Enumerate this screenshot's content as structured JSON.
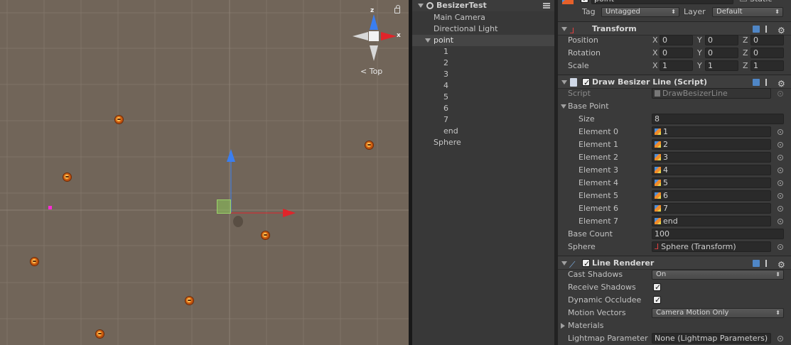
{
  "scene": {
    "view_label": "Top",
    "axes": {
      "x": "x",
      "z": "z"
    }
  },
  "hierarchy": {
    "scene_name": "BesizerTest",
    "items": [
      {
        "label": "Main Camera"
      },
      {
        "label": "Directional Light"
      },
      {
        "label": "point"
      },
      {
        "label": "1"
      },
      {
        "label": "2"
      },
      {
        "label": "3"
      },
      {
        "label": "4"
      },
      {
        "label": "5"
      },
      {
        "label": "6"
      },
      {
        "label": "7"
      },
      {
        "label": "end"
      },
      {
        "label": "Sphere"
      }
    ]
  },
  "inspector": {
    "object_name": "point",
    "static_label": "Static",
    "tag_label": "Tag",
    "tag_value": "Untagged",
    "layer_label": "Layer",
    "layer_value": "Default",
    "transform": {
      "title": "Transform",
      "position_label": "Position",
      "rotation_label": "Rotation",
      "scale_label": "Scale",
      "position": {
        "x": "0",
        "y": "0",
        "z": "0"
      },
      "rotation": {
        "x": "0",
        "y": "0",
        "z": "0"
      },
      "scale": {
        "x": "1",
        "y": "1",
        "z": "1"
      },
      "x": "X",
      "y": "Y",
      "z": "Z"
    },
    "script_component": {
      "title": "Draw Besizer Line (Script)",
      "script_label": "Script",
      "script_value": "DrawBesizerLine",
      "base_point_label": "Base Point",
      "size_label": "Size",
      "size_value": "8",
      "elements": [
        {
          "label": "Element 0",
          "value": "1"
        },
        {
          "label": "Element 1",
          "value": "2"
        },
        {
          "label": "Element 2",
          "value": "3"
        },
        {
          "label": "Element 3",
          "value": "4"
        },
        {
          "label": "Element 4",
          "value": "5"
        },
        {
          "label": "Element 5",
          "value": "6"
        },
        {
          "label": "Element 6",
          "value": "7"
        },
        {
          "label": "Element 7",
          "value": "end"
        }
      ],
      "base_count_label": "Base Count",
      "base_count_value": "100",
      "sphere_label": "Sphere",
      "sphere_value": "Sphere (Transform)"
    },
    "line_renderer": {
      "title": "Line Renderer",
      "cast_shadows_label": "Cast Shadows",
      "cast_shadows_value": "On",
      "receive_shadows_label": "Receive Shadows",
      "dynamic_occludee_label": "Dynamic Occludee",
      "motion_vectors_label": "Motion Vectors",
      "motion_vectors_value": "Camera Motion Only",
      "materials_label": "Materials",
      "lightmap_label": "Lightmap Parameter",
      "lightmap_value": "None (Lightmap Parameters)"
    }
  },
  "colors": {
    "scene_bg": "#716559",
    "panel_bg": "#383838",
    "inspector_bg": "#3a3a3a",
    "x_axis": "#e0242a",
    "y_axis": "#3a7ef0",
    "marker": "#e9821d"
  }
}
